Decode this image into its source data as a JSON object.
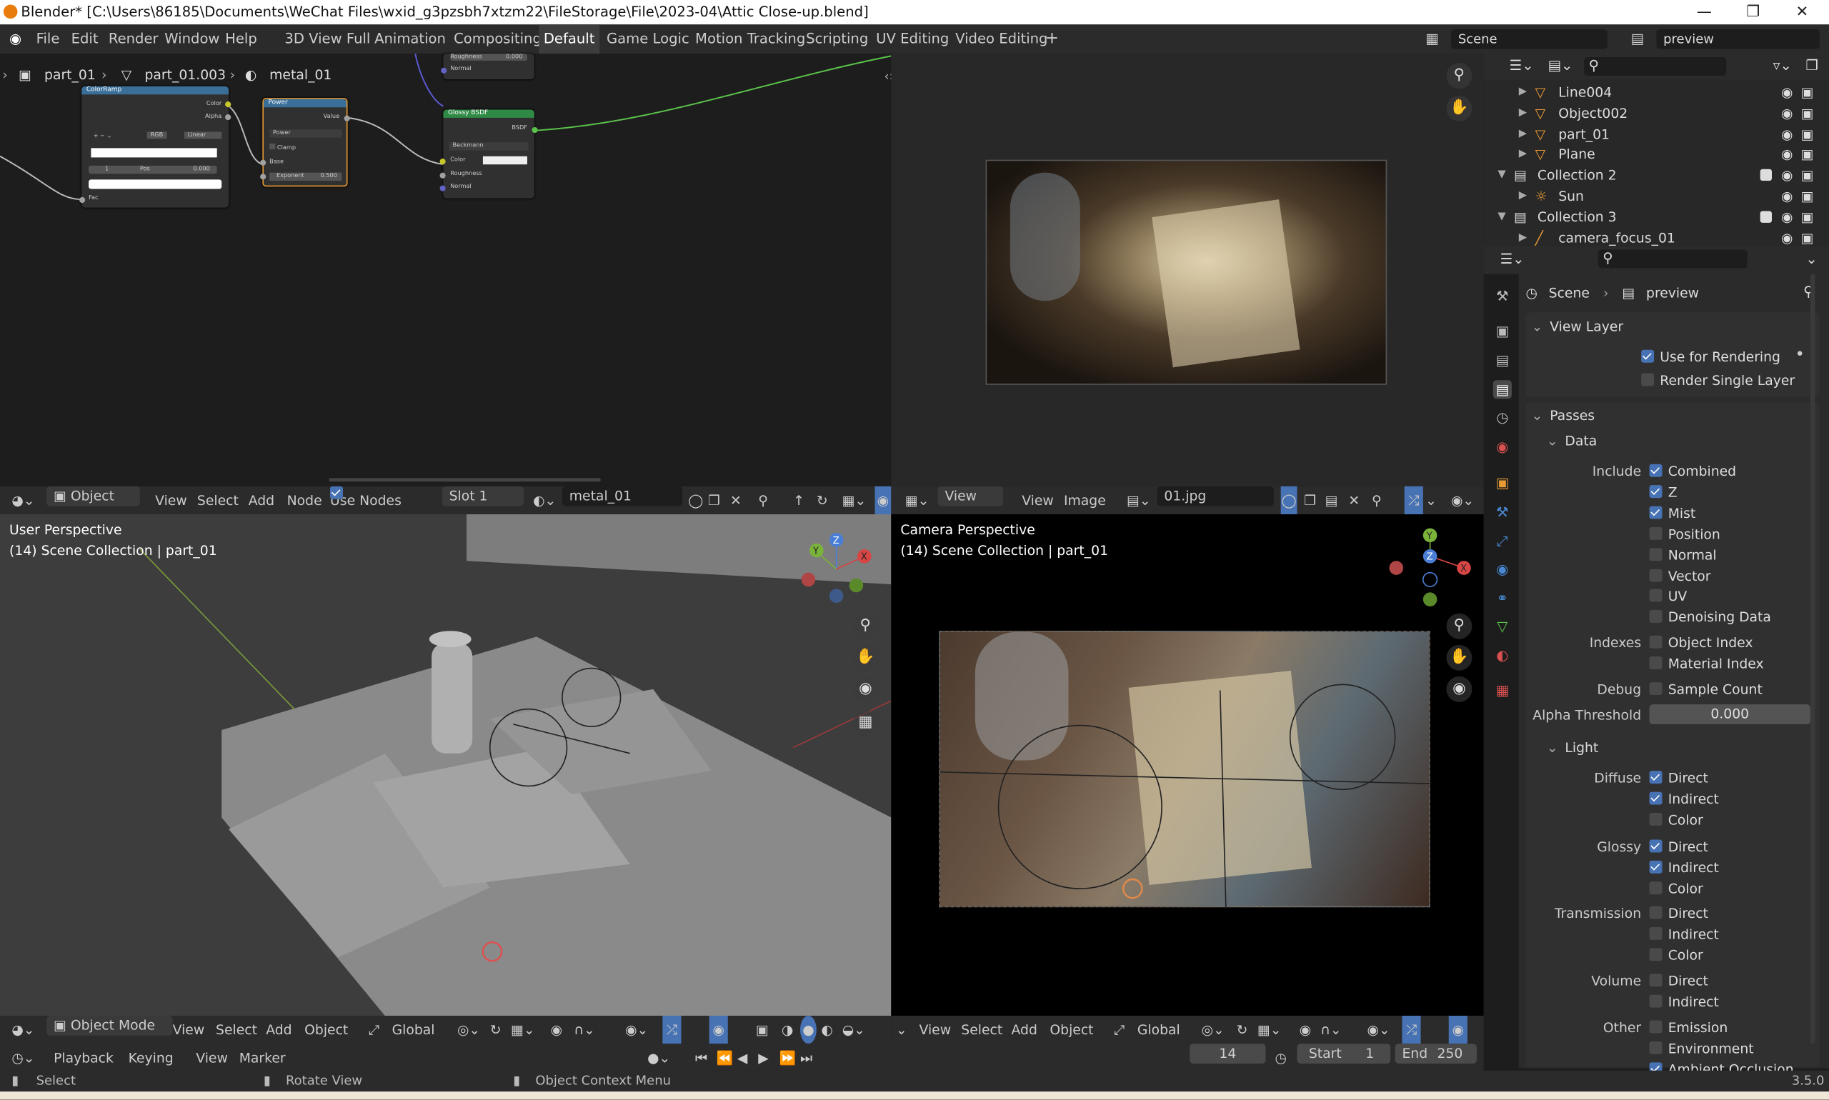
{
  "titlebar": {
    "title": "Blender* [C:\\Users\\86185\\Documents\\WeChat Files\\wxid_g3pzsbh7xtzm22\\FileStorage\\File\\2023-04\\Attic Close-up.blend]"
  },
  "menu": [
    "File",
    "Edit",
    "Render",
    "Window",
    "Help"
  ],
  "workspaces": [
    "3D View Full",
    "Animation",
    "Compositing",
    "Default",
    "Game Logic",
    "Motion Tracking",
    "Scripting",
    "UV Editing",
    "Video Editing"
  ],
  "active_workspace": "Default",
  "scene_field": "Scene",
  "viewlayer_field": "preview",
  "node_editor": {
    "breadcrumb": [
      "part_01",
      "part_01.003",
      "metal_01"
    ],
    "header": {
      "mode": "Object",
      "menus": [
        "View",
        "Select",
        "Add",
        "Node"
      ],
      "use_nodes": "Use Nodes",
      "slot": "Slot 1",
      "material": "metal_01"
    },
    "nodes": {
      "colorramp": {
        "title": "ColorRamp",
        "out1": "Color",
        "out2": "Alpha",
        "mode": "RGB",
        "interp": "Linear",
        "idx": "1",
        "pos_label": "Pos",
        "pos": "0.000",
        "fac": "Fac"
      },
      "power": {
        "title": "Power",
        "value": "Value",
        "op": "Power",
        "clamp": "Clamp",
        "base": "Base",
        "exp_label": "Exponent",
        "exp": "0.500"
      },
      "glossy": {
        "title": "Glossy BSDF",
        "bsdf": "BSDF",
        "dist": "Beckmann",
        "color": "Color",
        "rough": "Roughness",
        "normal": "Normal"
      },
      "top": {
        "rough": "Roughness",
        "rough_val": "0.000",
        "normal": "Normal"
      }
    }
  },
  "image_editor": {
    "menus": [
      "View",
      "View",
      "Image"
    ],
    "image": "01.jpg"
  },
  "viewport_left": {
    "title": "User Perspective",
    "sub": "(14) Scene Collection | part_01",
    "footer": {
      "mode": "Object Mode",
      "menus": [
        "View",
        "Select",
        "Add",
        "Object"
      ],
      "orient": "Global"
    }
  },
  "viewport_right": {
    "title": "Camera Perspective",
    "sub": "(14) Scene Collection | part_01",
    "footer": {
      "menus": [
        "View",
        "Select",
        "Add",
        "Object"
      ],
      "orient": "Global"
    }
  },
  "outliner": [
    {
      "name": "Line004",
      "indent": 2
    },
    {
      "name": "Object002",
      "indent": 2
    },
    {
      "name": "part_01",
      "indent": 2
    },
    {
      "name": "Plane",
      "indent": 2
    },
    {
      "name": "Collection 2",
      "indent": 1
    },
    {
      "name": "Sun",
      "indent": 2
    },
    {
      "name": "Collection 3",
      "indent": 1
    },
    {
      "name": "camera_focus_01",
      "indent": 2
    }
  ],
  "properties": {
    "breadcrumb": [
      "Scene",
      "preview"
    ],
    "view_layer": {
      "title": "View Layer",
      "use_render": "Use for Rendering",
      "single": "Render Single Layer"
    },
    "passes": "Passes",
    "data": "Data",
    "include_label": "Include",
    "include": [
      {
        "l": "Combined",
        "on": true
      },
      {
        "l": "Z",
        "on": true
      },
      {
        "l": "Mist",
        "on": true
      },
      {
        "l": "Position",
        "on": false
      },
      {
        "l": "Normal",
        "on": false
      },
      {
        "l": "Vector",
        "on": false
      },
      {
        "l": "UV",
        "on": false
      },
      {
        "l": "Denoising Data",
        "on": false
      }
    ],
    "indexes_label": "Indexes",
    "indexes": [
      {
        "l": "Object Index",
        "on": false
      },
      {
        "l": "Material Index",
        "on": false
      }
    ],
    "debug_label": "Debug",
    "debug": "Sample Count",
    "alpha_label": "Alpha Threshold",
    "alpha": "0.000",
    "light": "Light",
    "diffuse_label": "Diffuse",
    "diffuse": [
      {
        "l": "Direct",
        "on": true
      },
      {
        "l": "Indirect",
        "on": true
      },
      {
        "l": "Color",
        "on": false
      }
    ],
    "glossy_label": "Glossy",
    "glossy": [
      {
        "l": "Direct",
        "on": true
      },
      {
        "l": "Indirect",
        "on": true
      },
      {
        "l": "Color",
        "on": false
      }
    ],
    "trans_label": "Transmission",
    "trans": [
      {
        "l": "Direct",
        "on": false
      },
      {
        "l": "Indirect",
        "on": false
      },
      {
        "l": "Color",
        "on": false
      }
    ],
    "volume_label": "Volume",
    "volume": [
      {
        "l": "Direct",
        "on": false
      },
      {
        "l": "Indirect",
        "on": false
      }
    ],
    "other_label": "Other",
    "other": [
      {
        "l": "Emission",
        "on": false
      },
      {
        "l": "Environment",
        "on": false
      },
      {
        "l": "Ambient Occlusion",
        "on": true
      }
    ]
  },
  "timeline": {
    "menus": [
      "Playback",
      "Keying",
      "View",
      "Marker"
    ],
    "frame": "14",
    "start_label": "Start",
    "start": "1",
    "end_label": "End",
    "end": "250"
  },
  "statusbar": {
    "select": "Select",
    "rotate": "Rotate View",
    "context": "Object Context Menu",
    "version": "3.5.0"
  },
  "colors": {
    "accent": "#4772b3",
    "orange": "#e89a34",
    "green_link": "#5bc24b"
  }
}
